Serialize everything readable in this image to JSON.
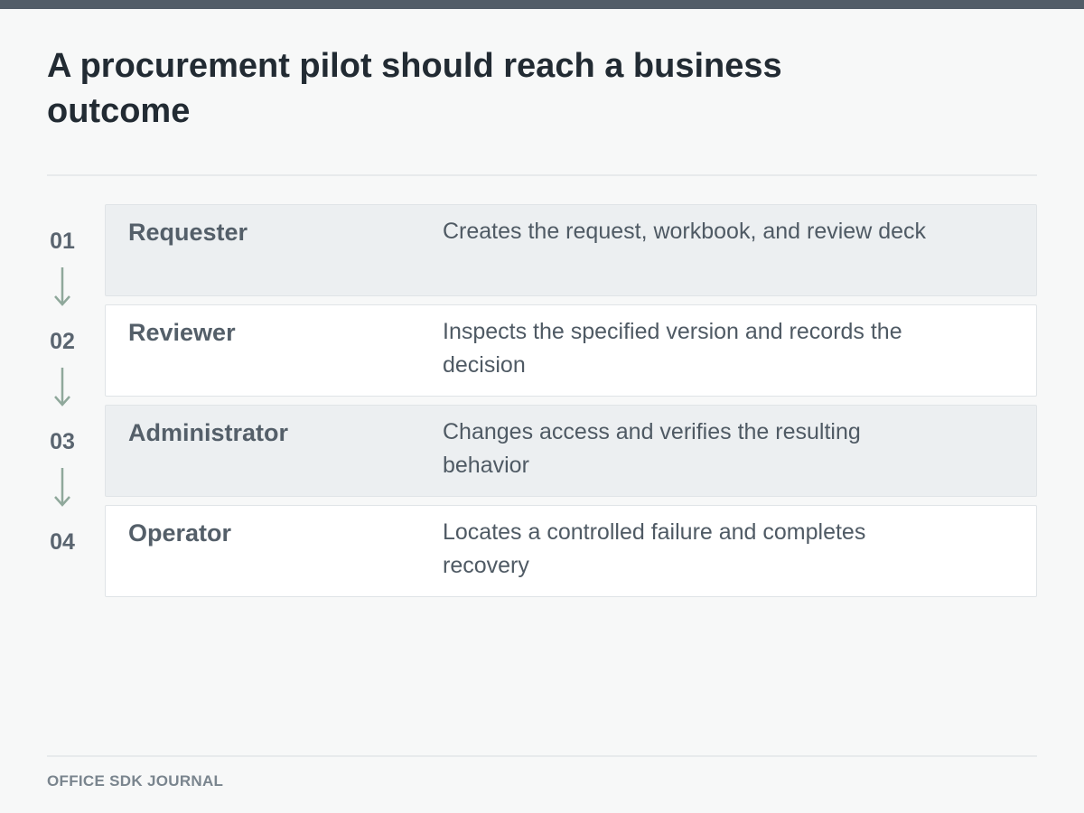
{
  "title": "A procurement pilot should reach a business outcome",
  "steps": [
    {
      "number": "01",
      "role": "Requester",
      "description": "Creates the request, workbook, and review deck"
    },
    {
      "number": "02",
      "role": "Reviewer",
      "description": "Inspects the specified version and records the decision"
    },
    {
      "number": "03",
      "role": "Administrator",
      "description": "Changes access and verifies the resulting behavior"
    },
    {
      "number": "04",
      "role": "Operator",
      "description": "Locates a controlled failure and completes recovery"
    }
  ],
  "footer": "OFFICE SDK JOURNAL",
  "colors": {
    "top_bar": "#525d68",
    "arrow": "#8fa89b",
    "card_shaded": "#eceff1",
    "card_plain": "#ffffff"
  }
}
